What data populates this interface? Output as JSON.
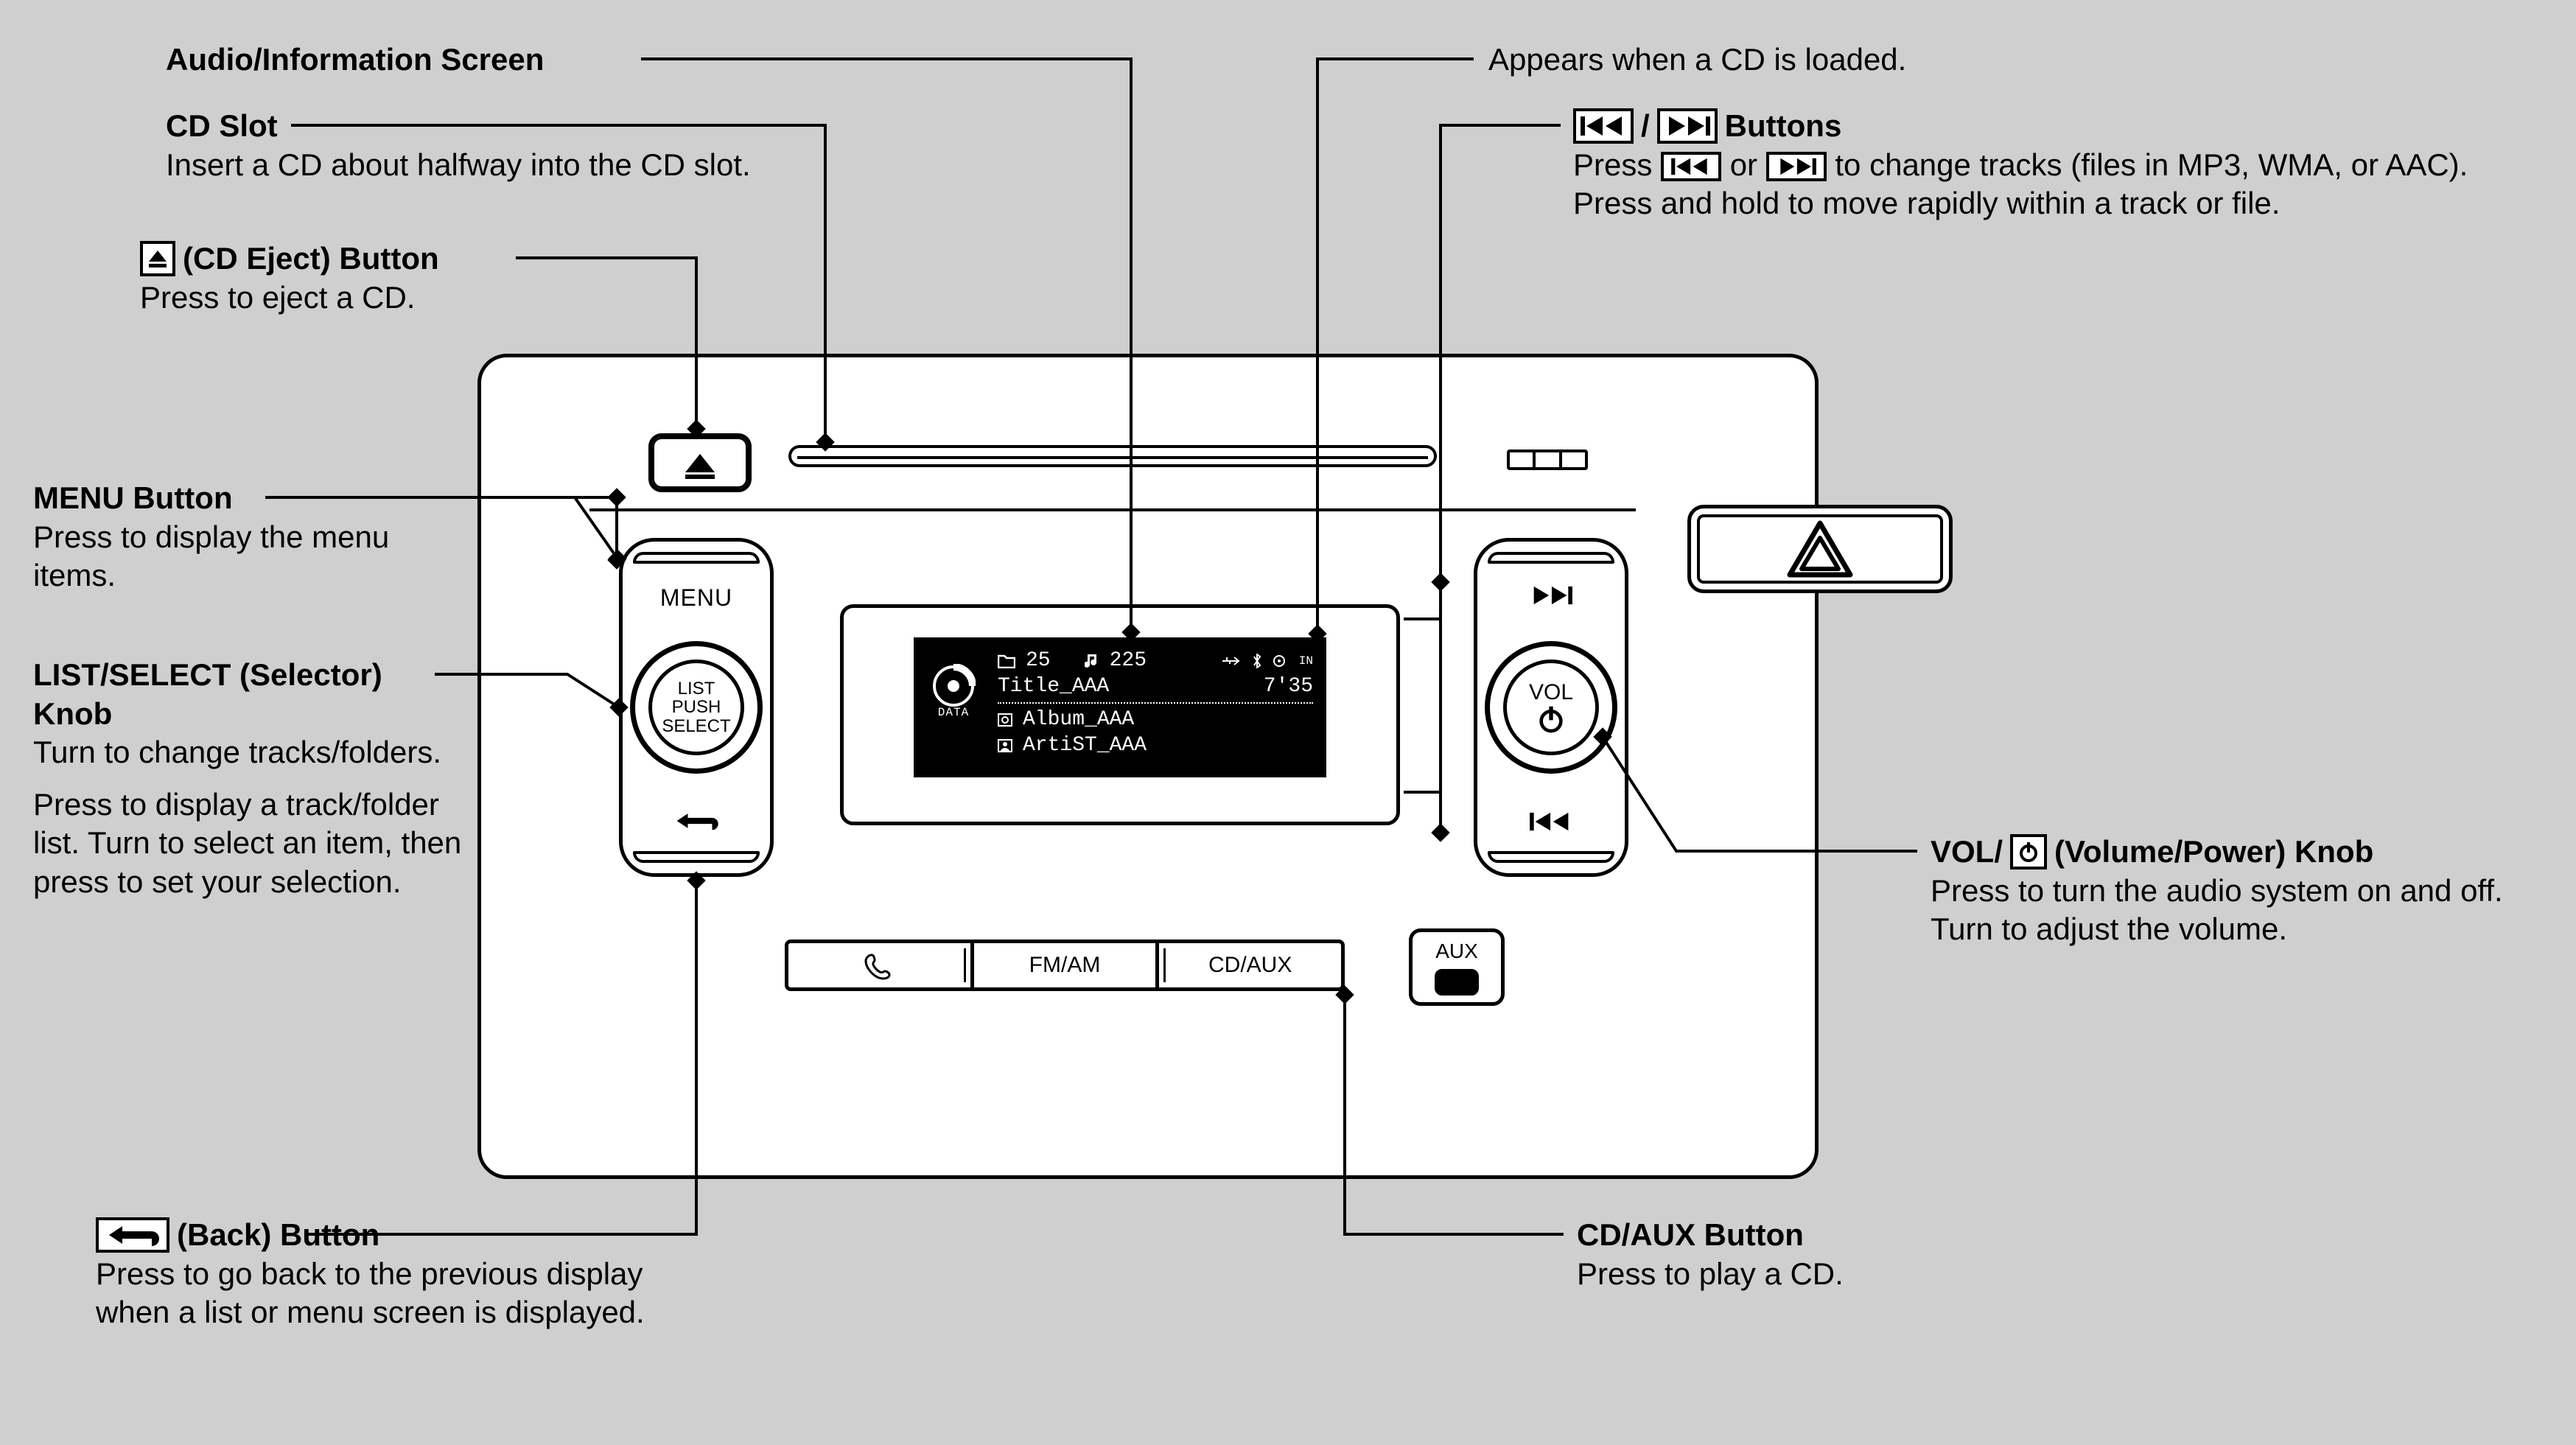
{
  "callouts": {
    "audio_info_screen": {
      "title": "Audio/Information Screen"
    },
    "cd_slot": {
      "title": "CD Slot",
      "body": "Insert a CD about halfway into the CD slot."
    },
    "cd_eject": {
      "title": "(CD Eject) Button",
      "body": "Press to eject a CD."
    },
    "menu_button": {
      "title": "MENU Button",
      "body": "Press to display the menu items."
    },
    "list_select": {
      "title": "LIST/SELECT (Selector) Knob",
      "body1": "Turn to change tracks/folders.",
      "body2": "Press to display a track/folder list. Turn to select an item, then press to set your selection."
    },
    "back_button": {
      "title": "(Back) Button",
      "body": "Press to go back to the previous display when a list or menu screen is displayed."
    },
    "cd_loaded": {
      "body": "Appears when a CD is loaded."
    },
    "seek_buttons": {
      "title": "Buttons",
      "sep": "/",
      "body1a": "Press ",
      "body1b": " or ",
      "body1c": " to change tracks (files in MP3, WMA, or AAC).",
      "body2": "Press and hold to move rapidly within a track or file."
    },
    "vol_knob": {
      "title_pre": "VOL/",
      "title_post": " (Volume/Power) Knob",
      "body1": "Press to turn the audio system on and off.",
      "body2": "Turn to adjust the volume."
    },
    "cd_aux": {
      "title": "CD/AUX Button",
      "body": "Press to play a CD."
    }
  },
  "panel": {
    "menu_label": "MENU",
    "list_knob_line1": "LIST",
    "list_knob_line2": "PUSH",
    "list_knob_line3": "SELECT",
    "vol_label": "VOL",
    "btn_fmam": "FM/AM",
    "btn_cdaux": "CD/AUX",
    "aux_label": "AUX"
  },
  "screen": {
    "folder_count": "25",
    "track_count": "225",
    "time": "7'35",
    "title": "Title_AAA",
    "album": "Album_AAA",
    "artist": "ArtiST_AAA",
    "data_label": "DATA",
    "in_label": "IN"
  }
}
